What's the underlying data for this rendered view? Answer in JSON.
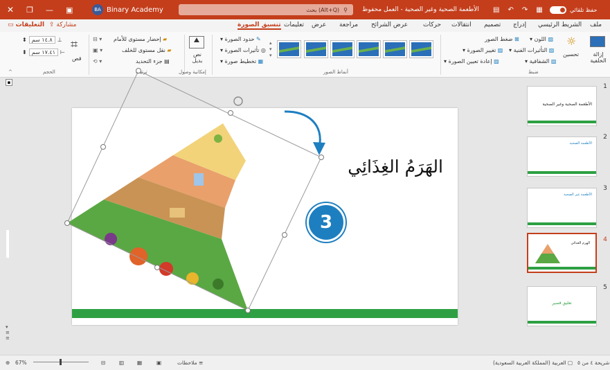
{
  "window": {
    "title": "الأطعمة الصحية وغير الصحية - العمل محفوظ",
    "autosave_label": "حفظ تلقائي",
    "account": "Binary Academy",
    "account_initials": "BA",
    "search_placeholder": "بحث (Alt+Q)"
  },
  "tabs": [
    "ملف",
    "الشريط الرئيسي",
    "إدراج",
    "تصميم",
    "انتقالات",
    "حركات",
    "عرض الشرائح",
    "مراجعة",
    "عرض",
    "تعليمات",
    "تنسيق الصورة"
  ],
  "active_tab": "تنسيق الصورة",
  "share_label": "مشاركة",
  "comments_label": "التعليقات",
  "ribbon": {
    "remove_bg": "إزالة الخلفية",
    "corrections": "تحسين",
    "color": "اللون",
    "artistic": "التأثيرات الفنية",
    "transparency": "الشفافية",
    "compress": "ضغط الصور",
    "change": "تغيير الصورة",
    "reset": "إعادة تعيين الصورة",
    "adjust_group": "ضبط",
    "styles_group": "أنماط الصور",
    "border": "حدود الصورة",
    "effects": "تأثيرات الصورة",
    "layout": "تخطيط صورة",
    "accessibility_group": "إمكانية وصول",
    "alt_text": "نص بديل",
    "bring_forward": "إحضار مستوى للأمام",
    "send_backward": "نقل مستوى للخلف",
    "selection_pane": "جزء التحديد",
    "arrange_group": "ترتيب",
    "crop": "قص",
    "height": "١٤.٨ سم",
    "width": "١٧.٤١ سم",
    "size_group": "الحجم"
  },
  "slide": {
    "title": "الهَرَمُ الغِذَائِي",
    "step_number": "3"
  },
  "thumbnails": [
    {
      "num": "1",
      "text": "الأطعمة الصحية وغير الصحية"
    },
    {
      "num": "2",
      "text": "الأطعمة الصحية"
    },
    {
      "num": "3",
      "text": "الأطعمة غير الصحية"
    },
    {
      "num": "4",
      "text": "الهرم الغذائي"
    },
    {
      "num": "5",
      "text": "تعليق قصير"
    }
  ],
  "status": {
    "slide_of": "شريحة ٤ من ٥",
    "language": "العربية (المملكة العربية السعودية)",
    "notes": "ملاحظات",
    "zoom": "67%"
  },
  "colors": {
    "accent": "#c43e1c",
    "green": "#2ea043",
    "step": "#1e7fc0"
  }
}
